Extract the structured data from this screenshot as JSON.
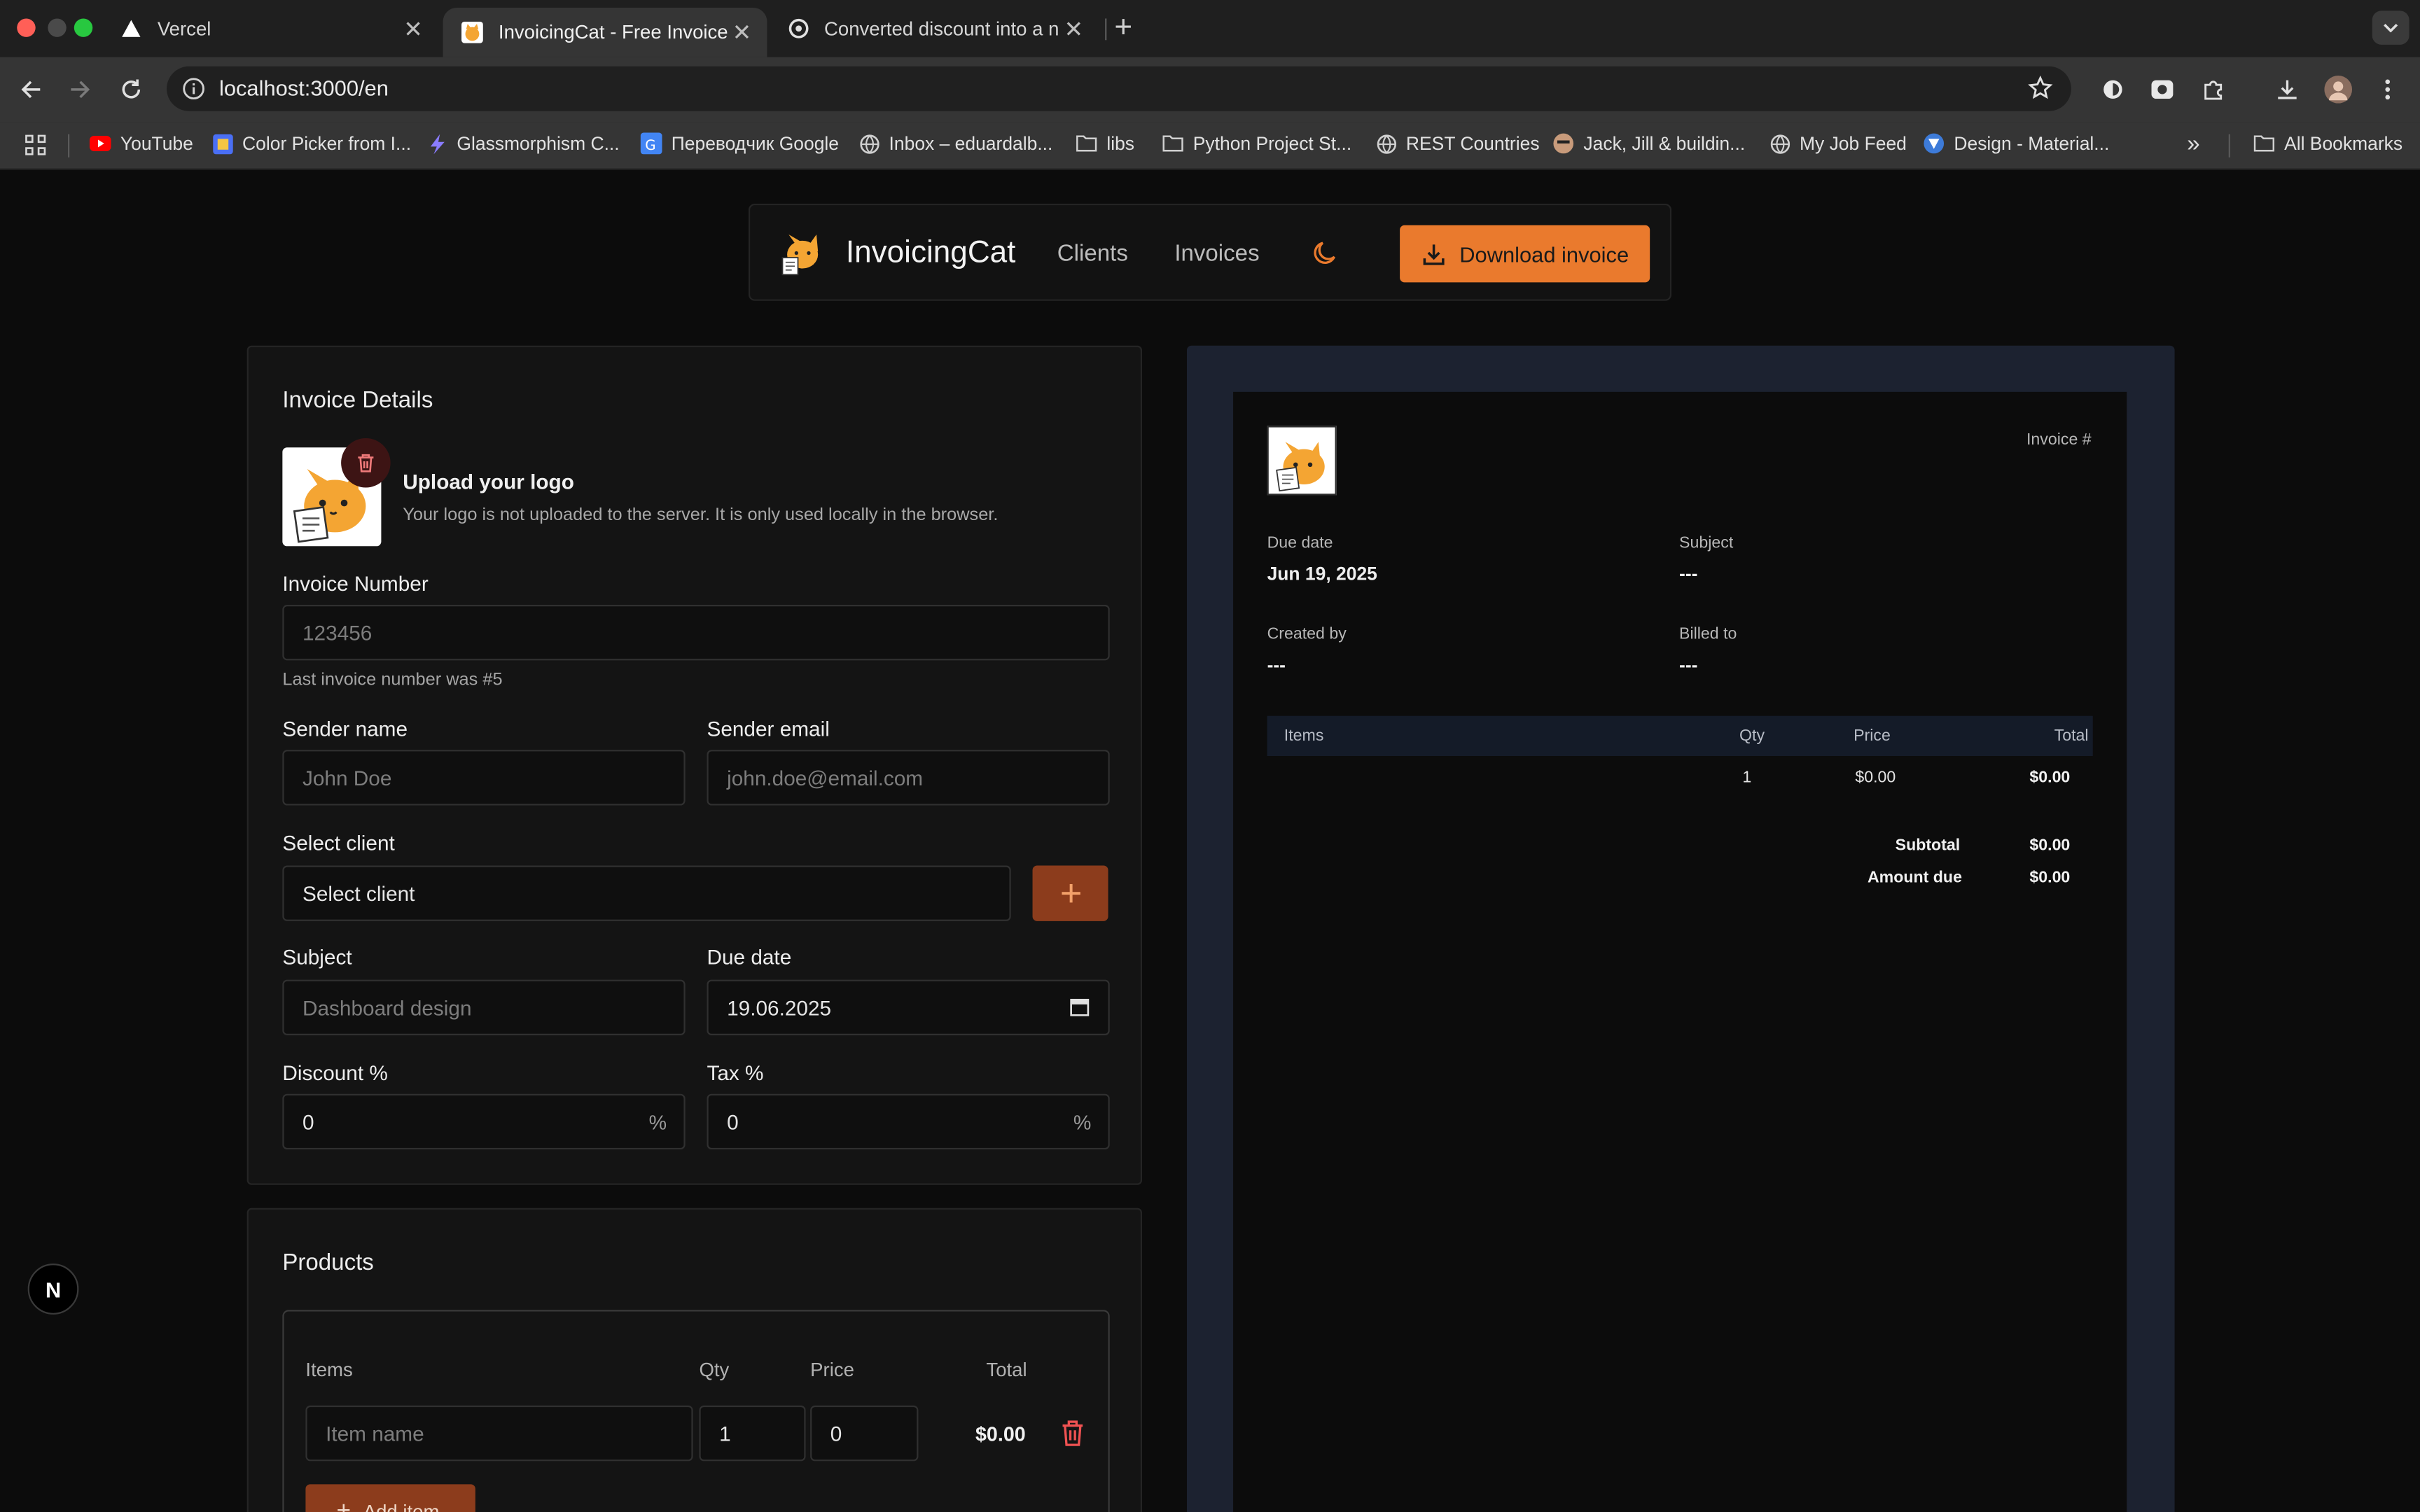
{
  "browser": {
    "tabs": [
      {
        "title": "Vercel"
      },
      {
        "title": "InvoicingCat - Free Invoice Ge"
      },
      {
        "title": "Converted discount into a num"
      }
    ],
    "url": "localhost:3000/en",
    "bookmarks": [
      "YouTube",
      "Color Picker from I...",
      "Glassmorphism C...",
      "Переводчик Google",
      "Inbox – eduardalb...",
      "libs",
      "Python Project St...",
      "REST Countries",
      "Jack, Jill & buildin...",
      "My Job Feed",
      "Design - Material..."
    ],
    "all_bookmarks": "All Bookmarks",
    "colors": {
      "accent": "#ea7a2d",
      "accent_dark": "#8c3c1c",
      "danger": "#f05252"
    }
  },
  "nav": {
    "brand": "InvoicingCat",
    "links": [
      "Clients",
      "Invoices"
    ],
    "download_label": "Download invoice"
  },
  "form": {
    "title": "Invoice Details",
    "upload_title": "Upload your logo",
    "upload_subtitle": "Your logo is not uploaded to the server. It is only used locally in the browser.",
    "invoice_number": {
      "label": "Invoice Number",
      "placeholder": "123456",
      "hint": "Last invoice number was #5"
    },
    "sender_name": {
      "label": "Sender name",
      "placeholder": "John Doe"
    },
    "sender_email": {
      "label": "Sender email",
      "placeholder": "john.doe@email.com"
    },
    "client": {
      "label": "Select client",
      "value": "Select client"
    },
    "subject": {
      "label": "Subject",
      "placeholder": "Dashboard design"
    },
    "due_date": {
      "label": "Due date",
      "value": "19.06.2025"
    },
    "discount": {
      "label": "Discount %",
      "value": "0",
      "suffix": "%"
    },
    "tax": {
      "label": "Tax %",
      "value": "0",
      "suffix": "%"
    }
  },
  "products": {
    "title": "Products",
    "headers": [
      "Items",
      "Qty",
      "Price",
      "Total"
    ],
    "row": {
      "item_placeholder": "Item name",
      "qty": "1",
      "price": "0",
      "total": "$0.00"
    },
    "add_label": "Add item"
  },
  "preview": {
    "invoice_label": "Invoice #",
    "due_date_label": "Due date",
    "due_date": "Jun 19, 2025",
    "subject_label": "Subject",
    "subject": "---",
    "created_by_label": "Created by",
    "created_by": "---",
    "billed_to_label": "Billed to",
    "billed_to": "---",
    "headers": [
      "Items",
      "Qty",
      "Price",
      "Total"
    ],
    "row": {
      "qty": "1",
      "price": "$0.00",
      "total": "$0.00"
    },
    "subtotal_label": "Subtotal",
    "subtotal": "$0.00",
    "amount_due_label": "Amount due",
    "amount_due": "$0.00"
  },
  "dev_badge": "N"
}
